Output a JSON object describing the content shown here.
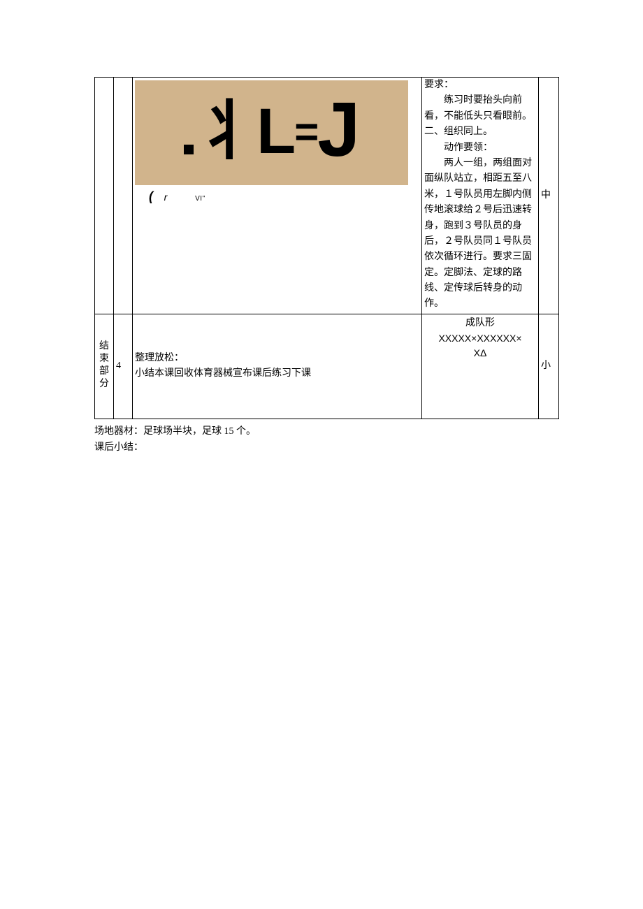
{
  "row1": {
    "section": "",
    "num": "",
    "img_glyphs": {
      "y": "丬",
      "L": "L",
      "eq": "=",
      "J": "J"
    },
    "below_image": {
      "paren": "(",
      "r": "r",
      "vi": "VI\""
    },
    "org": {
      "req_label": "要求：",
      "req_p1": "练习时要抬头向前看，不能低头只看眼前。",
      "sec2_label": "二、组织同上。",
      "essentials_label": "动作要领：",
      "essentials_body": "两人一组，两组面对面纵队站立，相距五至八米，１号队员用左脚内侧传地滚球给２号后迅速转身，跑到３号队员的身后，２号队员同１号队员依次循环进行。要求三固定。定脚法、定球的路线、定传球后转身的动作。"
    },
    "level": "中"
  },
  "row2": {
    "section": "结束部分",
    "num": "4",
    "content_line1": "整理放松：",
    "content_line2": "小结本课回收体育器械宣布课后练习下课",
    "org": {
      "heading": "成队形",
      "formation_line1": "XXXXX×XXXXXX×",
      "formation_line2": "XΔ"
    },
    "level": "小"
  },
  "after": {
    "equipment_label": "场地器材：",
    "equipment_value": "足球场半块，足球 15 个。",
    "summary_label": "课后小结："
  }
}
